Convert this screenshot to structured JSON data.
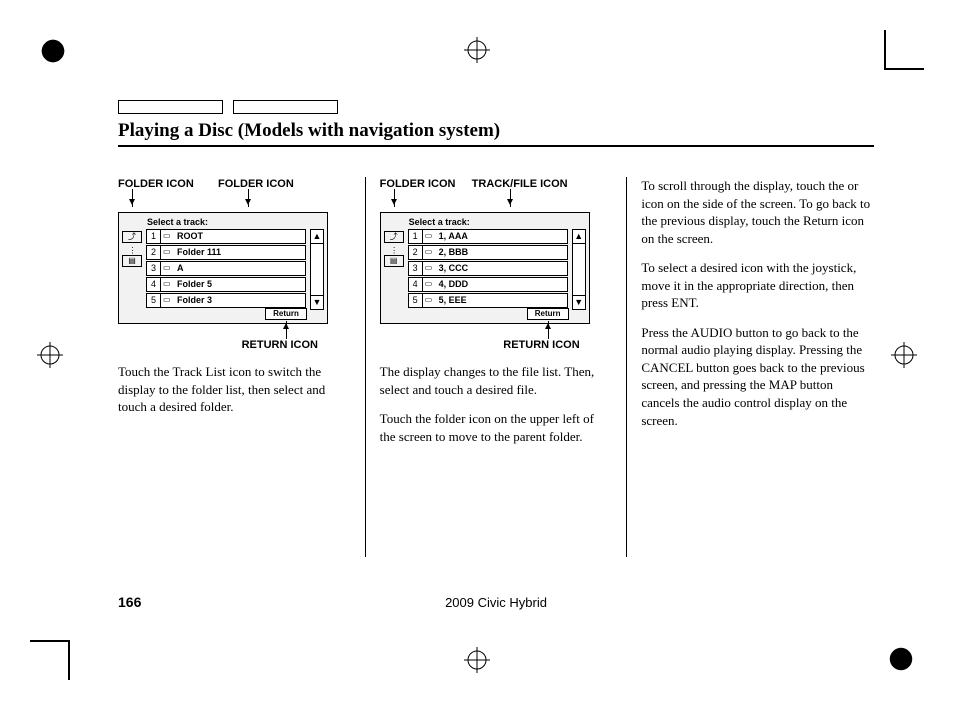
{
  "header": {
    "title": "Playing a Disc (Models with navigation system)"
  },
  "diagram1": {
    "label_left": "FOLDER ICON",
    "label_right": "FOLDER ICON",
    "label_bottom": "RETURN ICON",
    "panel_title": "Select a track:",
    "rows": [
      {
        "n": "1",
        "t": "ROOT"
      },
      {
        "n": "2",
        "t": "Folder 111"
      },
      {
        "n": "3",
        "t": "A"
      },
      {
        "n": "4",
        "t": "Folder 5"
      },
      {
        "n": "5",
        "t": "Folder 3"
      }
    ],
    "return": "Return"
  },
  "diagram2": {
    "label_left": "FOLDER ICON",
    "label_right": "TRACK/FILE ICON",
    "label_bottom": "RETURN ICON",
    "panel_title": "Select a track:",
    "rows": [
      {
        "n": "1",
        "t": "1, AAA"
      },
      {
        "n": "2",
        "t": "2, BBB"
      },
      {
        "n": "3",
        "t": "3, CCC"
      },
      {
        "n": "4",
        "t": "4, DDD"
      },
      {
        "n": "5",
        "t": "5, EEE"
      }
    ],
    "return": "Return"
  },
  "col1": {
    "p1": "Touch the Track List icon to switch the display to the folder list, then select and touch a desired folder."
  },
  "col2": {
    "p1": "The display changes to the file list. Then, select and touch a desired file.",
    "p2": "Touch the folder icon on the upper left of the screen to move to the parent folder."
  },
  "col3": {
    "p1": "To scroll through the display, touch the      or      icon on the side of the screen. To go back to the previous display, touch the Return icon on the screen.",
    "p2": "To select a desired icon with the joystick, move it in the appropriate direction, then press ENT.",
    "p3": "Press the AUDIO button to go back to the normal audio playing display. Pressing the CANCEL button goes back to the previous screen, and pressing the MAP button cancels the audio control display on the screen."
  },
  "footer": {
    "page": "166",
    "model": "2009  Civic  Hybrid"
  }
}
